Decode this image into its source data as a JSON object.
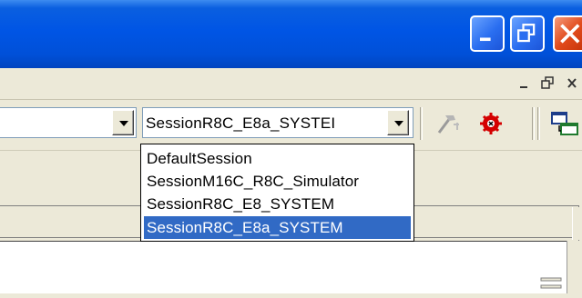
{
  "window": {
    "caption_buttons": [
      "minimize-icon",
      "restore-icon",
      "close-icon"
    ],
    "mdi_buttons": [
      "minimize-icon",
      "restore-icon",
      "close-icon"
    ]
  },
  "toolbar": {
    "combo1_value": "",
    "session_combo_value": "SessionR8C_E8a_SYSTEI",
    "icons": [
      "build-hammer-icon",
      "debug-connect-icon",
      "window-tile-icon"
    ]
  },
  "session_dropdown": {
    "options": [
      "DefaultSession",
      "SessionM16C_R8C_Simulator",
      "SessionR8C_E8_SYSTEM",
      "SessionR8C_E8a_SYSTEM"
    ],
    "selected_index": 3
  },
  "colors": {
    "title_bar": "#0055e5",
    "selection": "#316ac5",
    "close_button": "#e14a1b"
  }
}
